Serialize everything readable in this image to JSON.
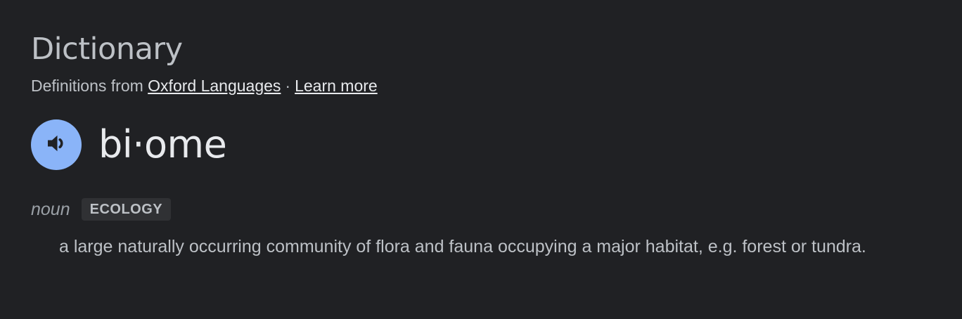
{
  "header": {
    "title": "Dictionary",
    "source_prefix": "Definitions from",
    "source_link": "Oxford Languages",
    "separator": "·",
    "learn_more": "Learn more"
  },
  "entry": {
    "headword": "bi·ome",
    "pronounce_icon": "speaker-icon",
    "part_of_speech": "noun",
    "subject_label": "ECOLOGY",
    "definition": "a large naturally occurring community of flora and fauna occupying a major habitat, e.g. forest or tundra."
  },
  "colors": {
    "background": "#202124",
    "accent": "#8ab4f8",
    "text_primary": "#e8eaed",
    "text_secondary": "#bdc1c6",
    "badge_bg": "#303134"
  }
}
